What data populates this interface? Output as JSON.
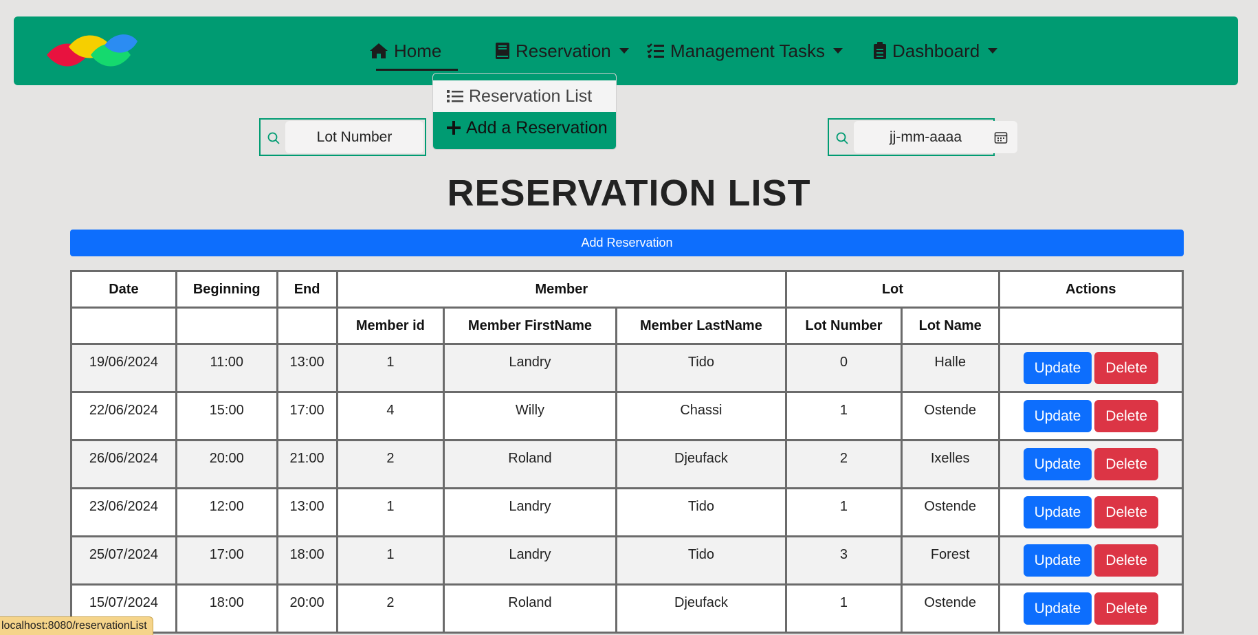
{
  "nav": {
    "home": "Home",
    "reservation": "Reservation",
    "management": "Management Tasks",
    "dashboard": "Dashboard"
  },
  "dropdown": {
    "items": [
      "Reservation List",
      "Add a Reservation"
    ]
  },
  "search": {
    "lot_placeholder": "Lot Number",
    "date_placeholder": "jj-mm-aaaa"
  },
  "page_title": "RESERVATION LIST",
  "add_button": "Add Reservation",
  "table": {
    "headers": {
      "date": "Date",
      "beginning": "Beginning",
      "end": "End",
      "member": "Member",
      "lot": "Lot",
      "actions": "Actions",
      "member_id": "Member id",
      "member_first": "Member FirstName",
      "member_last": "Member LastName",
      "lot_number": "Lot Number",
      "lot_name": "Lot Name"
    },
    "rows": [
      {
        "date": "19/06/2024",
        "begin": "11:00",
        "end": "13:00",
        "member_id": "1",
        "first": "Landry",
        "last": "Tido",
        "lot_number": "0",
        "lot_name": "Halle"
      },
      {
        "date": "22/06/2024",
        "begin": "15:00",
        "end": "17:00",
        "member_id": "4",
        "first": "Willy",
        "last": "Chassi",
        "lot_number": "1",
        "lot_name": "Ostende"
      },
      {
        "date": "26/06/2024",
        "begin": "20:00",
        "end": "21:00",
        "member_id": "2",
        "first": "Roland",
        "last": "Djeufack",
        "lot_number": "2",
        "lot_name": "Ixelles"
      },
      {
        "date": "23/06/2024",
        "begin": "12:00",
        "end": "13:00",
        "member_id": "1",
        "first": "Landry",
        "last": "Tido",
        "lot_number": "1",
        "lot_name": "Ostende"
      },
      {
        "date": "25/07/2024",
        "begin": "17:00",
        "end": "18:00",
        "member_id": "1",
        "first": "Landry",
        "last": "Tido",
        "lot_number": "3",
        "lot_name": "Forest"
      },
      {
        "date": "15/07/2024",
        "begin": "18:00",
        "end": "20:00",
        "member_id": "2",
        "first": "Roland",
        "last": "Djeufack",
        "lot_number": "1",
        "lot_name": "Ostende"
      }
    ],
    "update_label": "Update",
    "delete_label": "Delete"
  },
  "status_url": "localhost:8080/reservationList",
  "colors": {
    "navbar": "#009b72",
    "primary": "#0d6efd",
    "danger": "#dc3545",
    "background": "#e5e4e3"
  },
  "icons": [
    "logo-icon",
    "home-icon",
    "book-icon",
    "checklist-icon",
    "clipboard-icon",
    "list-icon",
    "plus-icon",
    "search-icon",
    "calendar-icon"
  ]
}
